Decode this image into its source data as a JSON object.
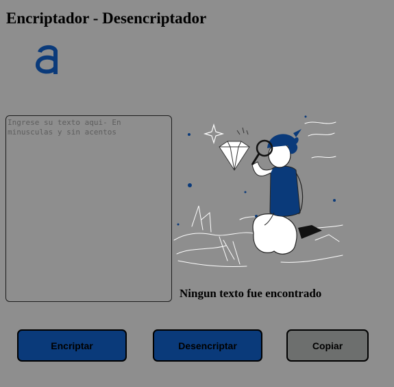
{
  "header": {
    "title": "Encriptador - Desencriptador",
    "logo_icon": "alura-a-logo-icon",
    "logo_color": "#0a3a7a"
  },
  "input": {
    "value": "",
    "placeholder": "Ingrese su texto aqui- En minusculas y sin acentos"
  },
  "output": {
    "illustration": "person-with-magnifying-glass-and-diamond-illustration",
    "message": "Ningun texto fue encontrado"
  },
  "buttons": {
    "encrypt_label": "Encriptar",
    "decrypt_label": "Desencriptar",
    "copy_label": "Copiar"
  },
  "colors": {
    "background": "#8e8e8e",
    "primary_button": "#0a3a7a",
    "secondary_button": "#6d6f6e",
    "figure_shirt": "#0a3a7a"
  }
}
